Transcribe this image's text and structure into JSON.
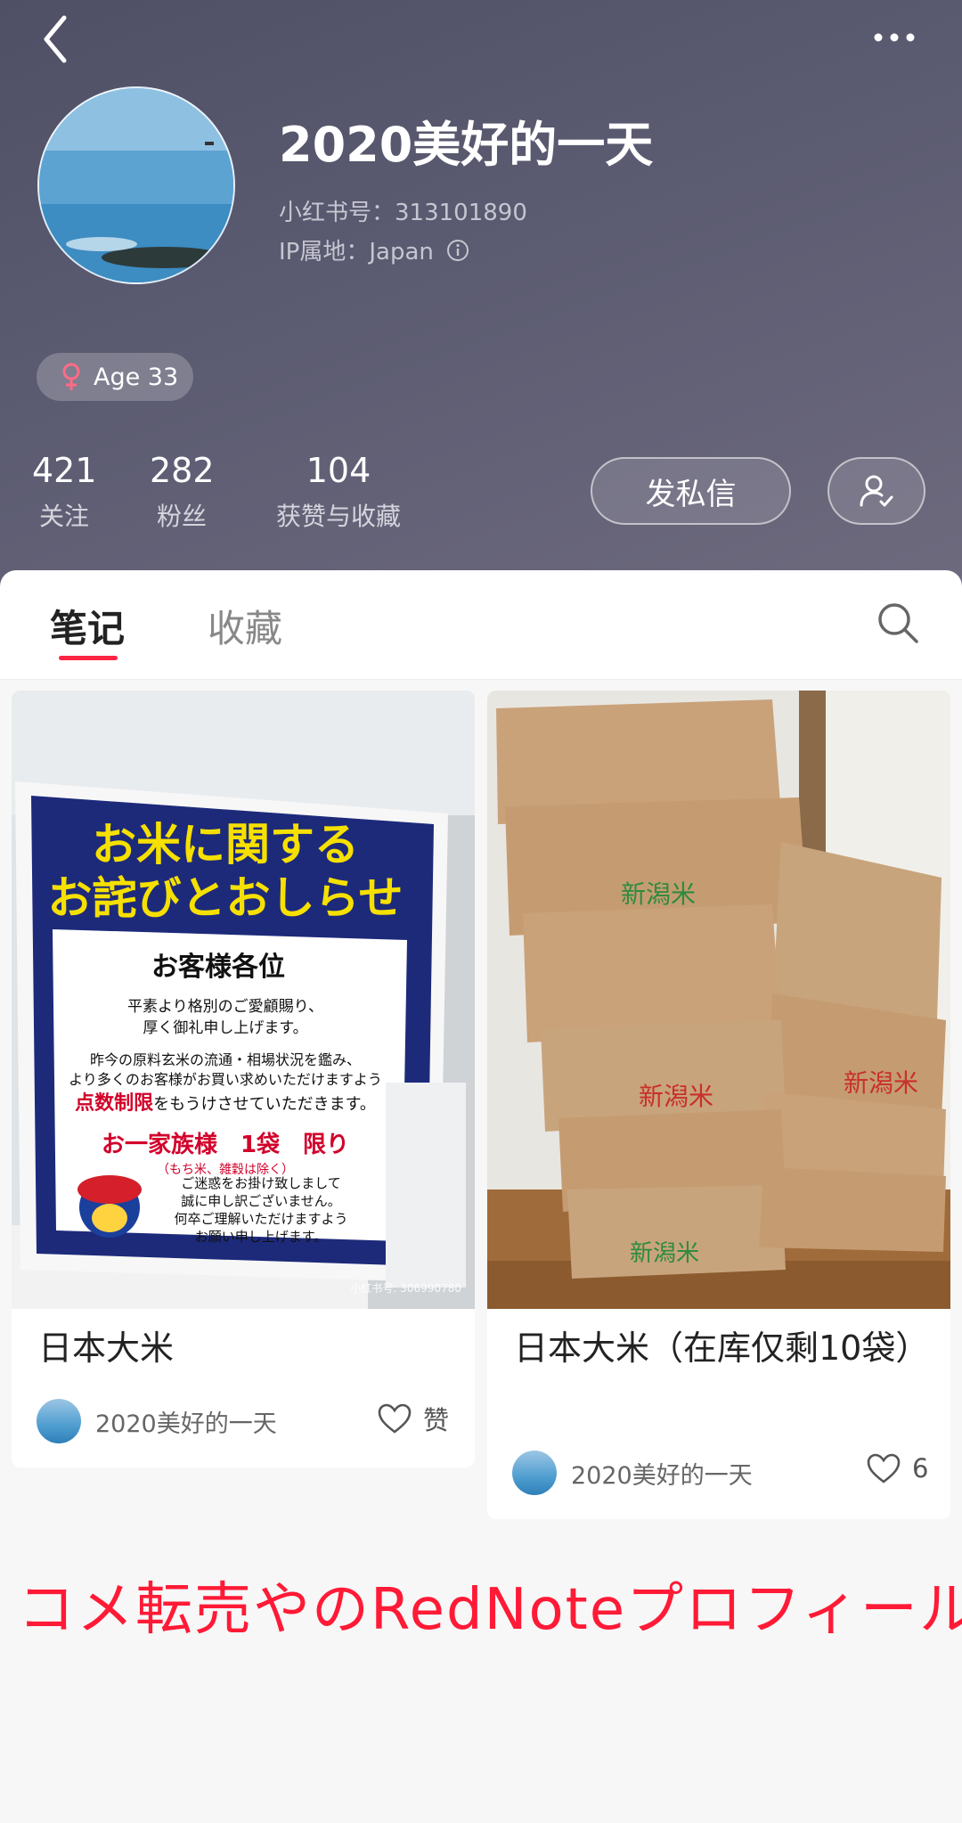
{
  "profile": {
    "name": "2020美好的一天",
    "redbook_id": "小红书号：313101890",
    "ip_location": "IP属地：Japan",
    "age_tag": "Age 33"
  },
  "stats": [
    {
      "value": "421",
      "label": "关注"
    },
    {
      "value": "282",
      "label": "粉丝"
    },
    {
      "value": "104",
      "label": "获赞与收藏"
    }
  ],
  "buttons": {
    "message": "发私信"
  },
  "tabs": [
    {
      "label": "笔记",
      "active": true
    },
    {
      "label": "收藏",
      "active": false
    }
  ],
  "notes": [
    {
      "title": "日本大米",
      "author": "2020美好的一天",
      "likes": "赞",
      "image_sign": {
        "headline": "お米に関する\nお詫びとおしらせ",
        "greeting": "お客様各位",
        "body1": "平素より格別のご愛顧賜り、\n厚く御礼申し上げます。",
        "body2": "昨今の原料玄米の流通・相場状況を鑑み、\nより多くのお客様がお買い求めいただけますよう",
        "limit_strong": "点数制限",
        "limit_rest": "をもうけさせていただきます。",
        "rule": "お一家族様　1袋　限り",
        "exception": "（もち米、雑穀は除く）",
        "apology": "ご迷惑をお掛け致しまして\n誠に申し訳ございません。\n何卒ご理解いただけますよう\nお願い申し上げます。",
        "watermark": "小红书号: 306990780"
      }
    },
    {
      "title": "日本大米（在库仅剩10袋）",
      "author": "2020美好的一天",
      "likes": "6",
      "bag_labels": [
        "新潟米",
        "新潟米",
        "新潟米",
        "新潟米"
      ]
    }
  ],
  "caption": "コメ転売やのRedNoteプロフィール",
  "colors": {
    "accent": "#ff2442",
    "caption": "#ff1a36",
    "header_bg": "#55556b"
  }
}
